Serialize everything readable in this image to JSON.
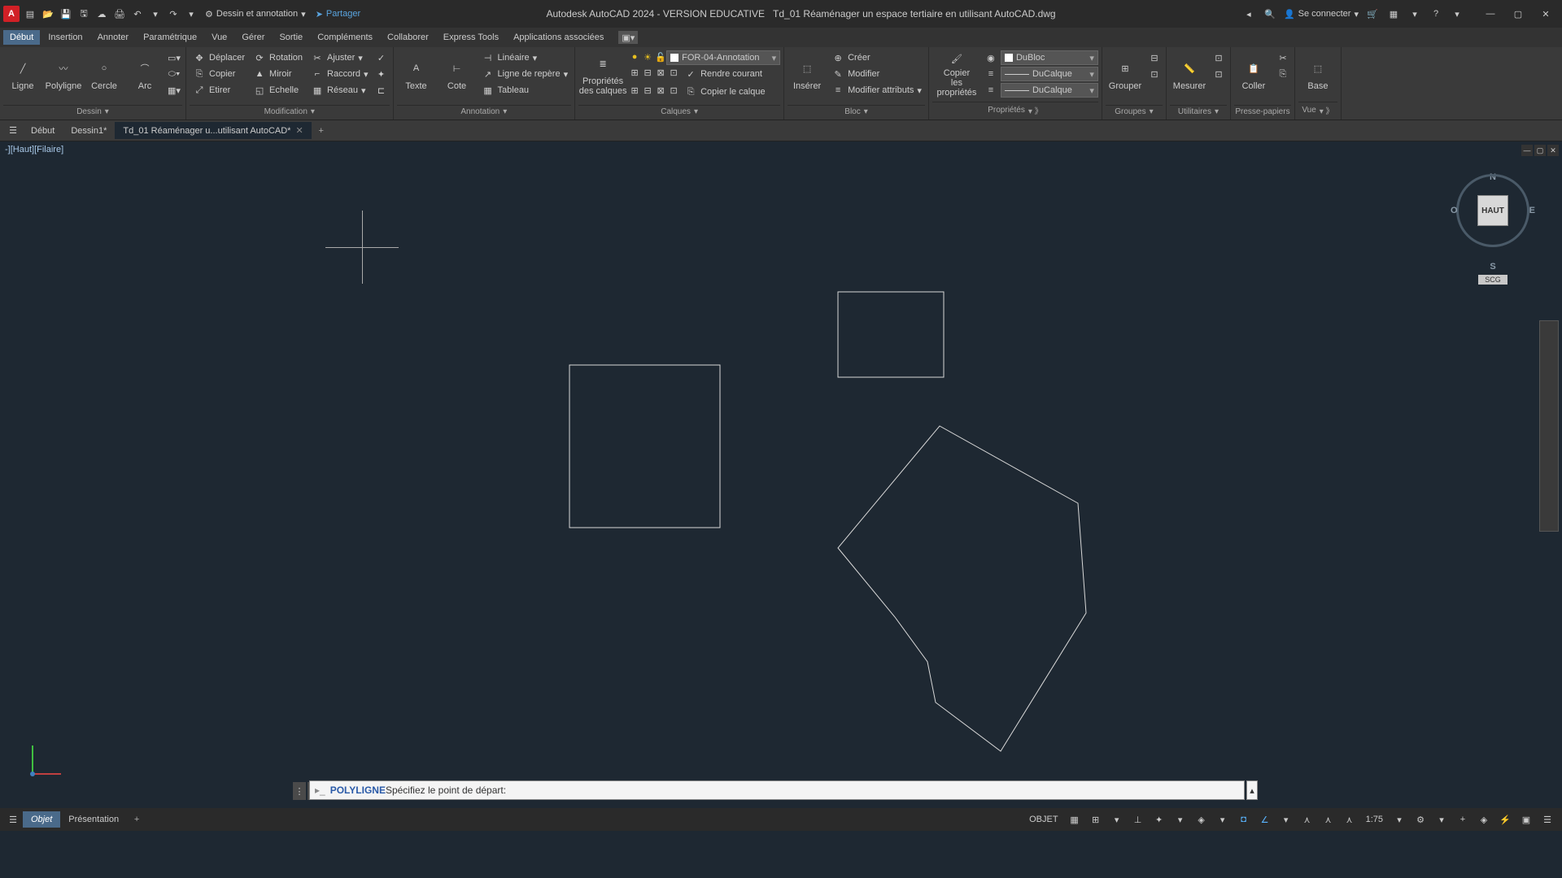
{
  "title": {
    "app": "Autodesk AutoCAD 2024 - VERSION EDUCATIVE",
    "file": "Td_01 Réaménager un espace tertiaire en utilisant AutoCAD.dwg"
  },
  "qat": {
    "workspace": "Dessin et annotation",
    "share": "Partager",
    "signin": "Se connecter"
  },
  "menu": {
    "items": [
      "Début",
      "Insertion",
      "Annoter",
      "Paramétrique",
      "Vue",
      "Gérer",
      "Sortie",
      "Compléments",
      "Collaborer",
      "Express Tools",
      "Applications associées"
    ]
  },
  "ribbon": {
    "dessin": {
      "title": "Dessin",
      "ligne": "Ligne",
      "polyligne": "Polyligne",
      "cercle": "Cercle",
      "arc": "Arc"
    },
    "modification": {
      "title": "Modification",
      "deplacer": "Déplacer",
      "rotation": "Rotation",
      "ajuster": "Ajuster",
      "copier": "Copier",
      "miroir": "Miroir",
      "raccord": "Raccord",
      "etirer": "Etirer",
      "echelle": "Echelle",
      "reseau": "Réseau"
    },
    "annotation": {
      "title": "Annotation",
      "texte": "Texte",
      "cote": "Cote",
      "lineaire": "Linéaire",
      "lignerepere": "Ligne de repère",
      "tableau": "Tableau"
    },
    "calques": {
      "title": "Calques",
      "proprietes": "Propriétés\ndes calques",
      "layer": "FOR-04-Annotation"
    },
    "bloc": {
      "title": "Bloc",
      "inserer": "Insérer",
      "creer": "Créer",
      "modifier": "Modifier",
      "modattrib": "Modifier attributs",
      "rendrecourant": "Rendre courant",
      "copiercalque": "Copier le calque"
    },
    "proprietes": {
      "title": "Propriétés",
      "copier": "Copier\nles propriétés",
      "color": "DuBloc",
      "ltype": "DuCalque",
      "lweight": "DuCalque"
    },
    "groupes": {
      "title": "Groupes",
      "grouper": "Grouper"
    },
    "utilitaires": {
      "title": "Utilitaires",
      "mesurer": "Mesurer"
    },
    "presse": {
      "title": "Presse-papiers",
      "coller": "Coller"
    },
    "vue": {
      "title": "Vue",
      "base": "Base"
    }
  },
  "filetabs": {
    "debut": "Début",
    "dessin1": "Dessin1*",
    "current": "Td_01 Réaménager u...utilisant AutoCAD*"
  },
  "viewport": {
    "label": "-][Haut][Filaire]"
  },
  "viewcube": {
    "face": "HAUT",
    "n": "N",
    "s": "S",
    "e": "E",
    "o": "O",
    "wcs": "SCG"
  },
  "cmd": {
    "prompt_cmd": "POLYLIGNE",
    "prompt_text": " Spécifiez le point de départ:"
  },
  "layout": {
    "objet": "Objet",
    "presentation": "Présentation"
  },
  "status": {
    "objet": "OBJET",
    "scale": "1:75"
  }
}
